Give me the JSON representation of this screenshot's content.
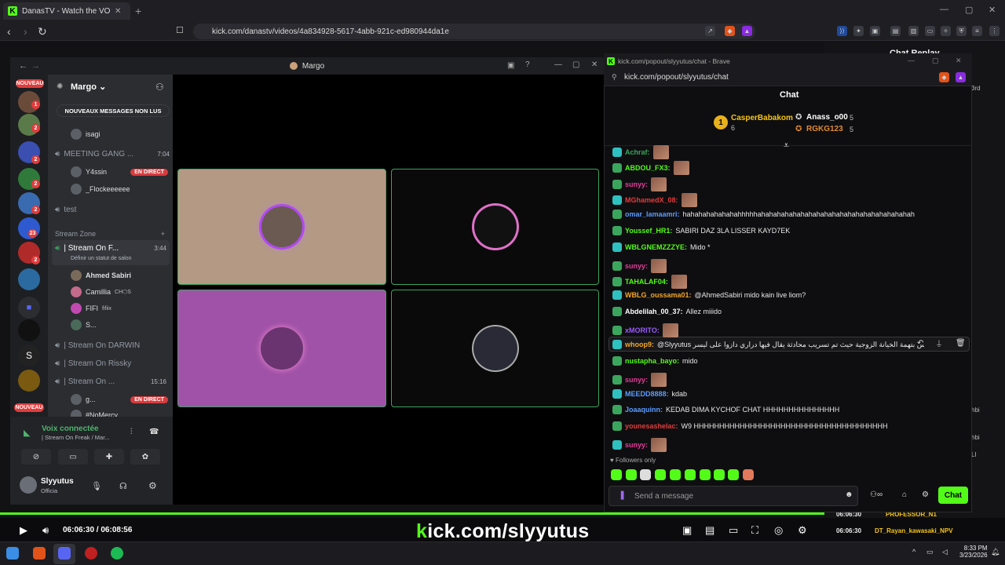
{
  "browser": {
    "tab_title": "DanasTV - Watch the VOD on Ki",
    "url": "kick.com/danastv/videos/4a834928-5617-4abb-921c-ed980944da1e"
  },
  "side_panel": {
    "title": "Chat Replay",
    "rows": [
      {
        "time": "06:06:30",
        "name": "PROFESSOR_N1"
      },
      {
        "time": "06:06:30",
        "name": "DT_Rayan_kawasaki_NPV"
      }
    ],
    "snippets": [
      "3rd",
      "hbi",
      "hbi",
      "LI"
    ]
  },
  "discord": {
    "window_title": "Margo",
    "server_name": "Margo",
    "unread_pill": "NOUVEAUX MESSAGES NON LUS",
    "new_badge": "NOUVEAU",
    "server_badges": [
      "1",
      "2",
      "2",
      "2",
      "2",
      "23",
      "2"
    ],
    "channels": [
      {
        "name": "isagi",
        "kind": "user"
      },
      {
        "name": "MEETING GANG ...",
        "time": "7:04"
      },
      {
        "name": "Y4ssin",
        "live": "EN DIRECT",
        "kind": "user"
      },
      {
        "name": "_Flockeeeeee",
        "kind": "user"
      },
      {
        "name": "test"
      },
      {
        "name": "Stream Zone",
        "kind": "category"
      },
      {
        "name": "| Stream On F...",
        "time": "3:44",
        "status": "Définir un statut de salon"
      },
      {
        "name": "Ahmed Sabiri",
        "kind": "user"
      },
      {
        "name": "Camillia",
        "tag": "CH⬡S",
        "kind": "user"
      },
      {
        "name": "FIFI",
        "tag": "fifiix",
        "kind": "user"
      },
      {
        "name": "S...",
        "kind": "user"
      },
      {
        "name": "| Stream On DARWIN"
      },
      {
        "name": "| Stream On Rissky"
      },
      {
        "name": "| Stream On ...",
        "time": "15:16"
      },
      {
        "name": "g...",
        "live": "EN DIRECT",
        "kind": "user"
      },
      {
        "name": "#NoMercy",
        "kind": "user"
      }
    ],
    "voice": {
      "title": "Voix connectée",
      "sub": "| Stream On Freak / Mar..."
    },
    "user": {
      "name": "Slyyutus",
      "status": "Officia"
    }
  },
  "chatwin": {
    "title": "kick.com/popout/slyyutus/chat - Brave",
    "url": "kick.com/popout/slyyutus/chat",
    "header": "Chat",
    "leaderboard": [
      {
        "rank": "1",
        "name": "CasperBabakom",
        "count": "6"
      },
      {
        "name": "Anass_o00",
        "count": "5"
      },
      {
        "name": "RGKG123",
        "count": "5"
      }
    ],
    "messages": [
      {
        "user": "Achraf:",
        "color": "#3ba55d",
        "text": "",
        "emote": true
      },
      {
        "user": "ABDOU_FX3:",
        "color": "#53fc18",
        "text": "",
        "emote": true
      },
      {
        "user": "sunyy:",
        "color": "#e33c9a",
        "text": "",
        "emote": true
      },
      {
        "user": "MGhamedX_08:",
        "color": "#e33c3c",
        "text": "",
        "emote": true
      },
      {
        "user": "omar_lamaamri:",
        "color": "#5b9bff",
        "text": "hahahahahahahahhhhhahahahahahahahahahahahahahahahahahahahah"
      },
      {
        "user": "Youssef_HR1:",
        "color": "#53fc18",
        "text": "SABIRI DAZ 3LA LISSER KAYD7EK"
      },
      {
        "user": "WBLGNEMZZZYE:",
        "color": "#53fc18",
        "text": "Mido *"
      },
      {
        "user": "sunyy:",
        "color": "#e33c9a",
        "text": "",
        "emote": true
      },
      {
        "user": "TAHALAF04:",
        "color": "#53fc18",
        "text": "",
        "emote": true
      },
      {
        "user": "WBLG_oussama01:",
        "color": "#f5a623",
        "text": "@AhmedSabiri mido kain live liom?"
      },
      {
        "user": "Abdelilah_00_37:",
        "color": "#ffffff",
        "text": "Allez miiido"
      },
      {
        "user": "xMORITO:",
        "color": "#9b59ff",
        "text": "",
        "emote": true
      },
      {
        "user": "whoop9:",
        "color": "#f5a623",
        "text": "@Slyyutus ‏على المدعي بسلايتوس بتهمة الخيانة الزوجية حيث تم تسريب محادثة يقال فيها دراري دازوا على ليسر"
      },
      {
        "user": "nustapha_bayo:",
        "color": "#53fc18",
        "text": "mido"
      },
      {
        "user": "sunyy:",
        "color": "#e33c9a",
        "text": "",
        "emote": true
      },
      {
        "user": "MEEDD8888:",
        "color": "#5b9bff",
        "text": "kdab"
      },
      {
        "user": "Joaaquinn:",
        "color": "#5b9bff",
        "text": "KEDAB DIMA KYCHOF CHAT HHHHHHHHHHHHHHH"
      },
      {
        "user": "younesashelac:",
        "color": "#e33c3c",
        "text": "W9 HHHHHHHHHHHHHHHHHHHHHHHHHHHHHHHHHHHHHH"
      },
      {
        "user": "sunyy:",
        "color": "#e33c9a",
        "text": "",
        "emote": true
      }
    ],
    "followers_only": "Followers only",
    "send_placeholder": "Send a message",
    "chat_button": "Chat"
  },
  "player": {
    "time": "06:06:30 / 06:08:56",
    "brand_k": "k",
    "brand_rest": "ick.com/slyyutus",
    "progress": 1.0
  },
  "taskbar": {
    "time": "8:33 PM",
    "date": "3/23/2026"
  },
  "colors": {
    "kick_green": "#53fc18",
    "discord_green": "#3ba55d",
    "live_red": "#d83c3e"
  }
}
